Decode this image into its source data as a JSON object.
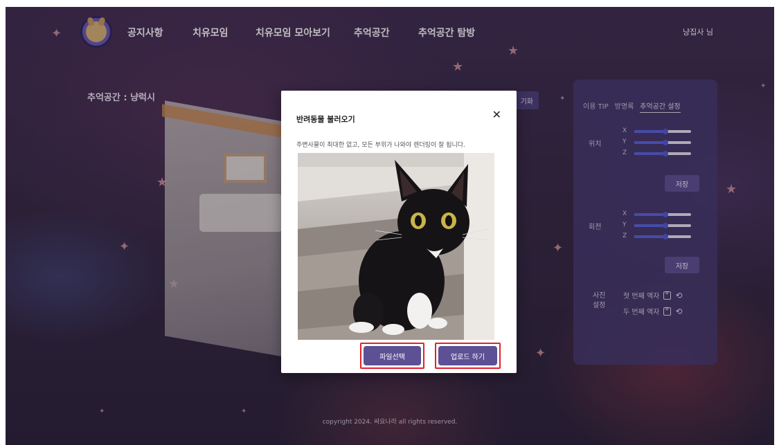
{
  "nav": {
    "items": [
      "공지사항",
      "치유모임",
      "치유모임 모아보기",
      "추억공간",
      "추억공간 탐방"
    ],
    "user": "냥집사 님"
  },
  "room": {
    "title": "추억공간 : 냥럭시"
  },
  "background_buttons": {
    "visualize_fragment": "기화"
  },
  "panel": {
    "tabs": [
      "이용 TIP",
      "방명록",
      "추억공간 설정"
    ],
    "active_tab": "추억공간 설정",
    "position_label": "위치",
    "rotation_label": "회전",
    "axes": [
      "X",
      "Y",
      "Z"
    ],
    "position_values": [
      0.55,
      0.55,
      0.55
    ],
    "rotation_values": [
      0.55,
      0.55,
      0.55
    ],
    "save_label": "저장",
    "photo_label": "사진 설정",
    "frames": [
      "첫 번째 액자",
      "두 번째 액자"
    ]
  },
  "modal": {
    "title": "반려동물 불러오기",
    "close": "✕",
    "hint": "주변사물이 최대한 없고, 모든 부위가 나와야 렌더링이 잘 됩니다.",
    "select_file": "파일선택",
    "upload": "업로드 하기"
  },
  "footer": {
    "copyright": "copyright 2024. 싸요나라 all rights reserved."
  },
  "colors": {
    "accent": "#5d5094",
    "highlight": "#e2212a",
    "panel": "#463a70"
  }
}
